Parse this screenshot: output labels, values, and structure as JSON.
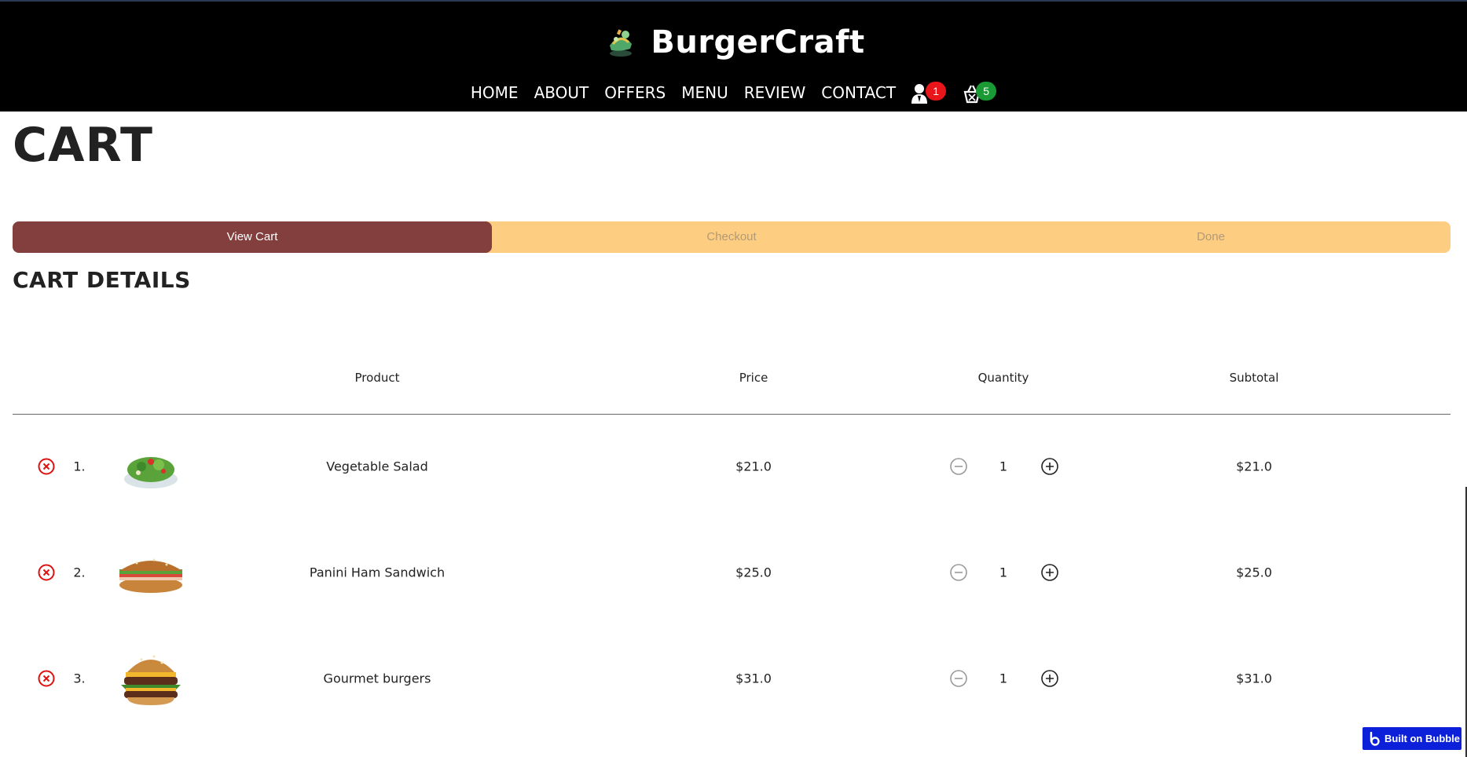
{
  "header": {
    "brand": "BurgerCraft",
    "logo_icon": "burger-logo-icon",
    "nav": [
      "HOME",
      "ABOUT",
      "OFFERS",
      "MENU",
      "REVIEW",
      "CONTACT"
    ],
    "user_badge": "1",
    "cart_badge": "5",
    "user_badge_color": "#e8151b",
    "cart_badge_color": "#1a9a35"
  },
  "page": {
    "title": "CART",
    "section_title": "CART DETAILS"
  },
  "stepper": {
    "steps": [
      "View Cart",
      "Checkout",
      "Done"
    ],
    "active": 0,
    "active_color": "#833f3d",
    "inactive_color": "#fdcd82"
  },
  "table": {
    "columns": [
      "Product",
      "Price",
      "Quantity",
      "Subtotal"
    ],
    "rows": [
      {
        "index": "1.",
        "product": "Vegetable Salad",
        "price": "$21.0",
        "quantity": "1",
        "subtotal": "$21.0",
        "image_icon": "salad-image"
      },
      {
        "index": "2.",
        "product": "Panini Ham Sandwich",
        "price": "$25.0",
        "quantity": "1",
        "subtotal": "$25.0",
        "image_icon": "sandwich-image"
      },
      {
        "index": "3.",
        "product": "Gourmet burgers",
        "price": "$31.0",
        "quantity": "1",
        "subtotal": "$31.0",
        "image_icon": "burger-image"
      }
    ]
  },
  "footer_badge": {
    "label": "Built on Bubble"
  }
}
